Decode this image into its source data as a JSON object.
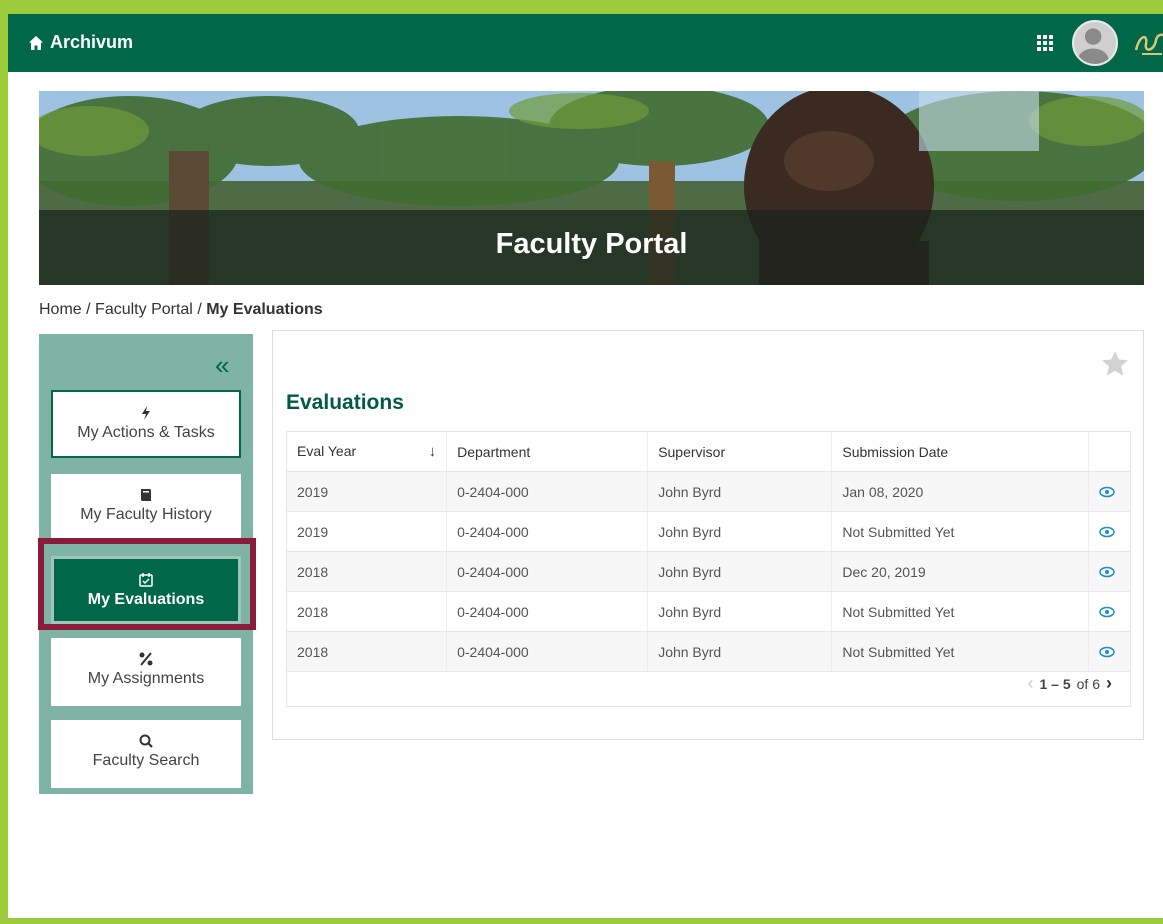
{
  "app": {
    "title": "Archivum"
  },
  "banner": {
    "title": "Faculty Portal"
  },
  "breadcrumb": {
    "home": "Home",
    "separator": "/",
    "section": "Faculty Portal",
    "current": "My Evaluations"
  },
  "sidebar": {
    "collapse_glyph": "«",
    "items": [
      {
        "label": "My Actions & Tasks",
        "icon": "bolt-icon"
      },
      {
        "label": "My Faculty History",
        "icon": "book-icon"
      },
      {
        "label": "My Evaluations",
        "icon": "calendar-check-icon",
        "active": true
      },
      {
        "label": "My Assignments",
        "icon": "percent-icon"
      },
      {
        "label": "Faculty Search",
        "icon": "search-icon"
      }
    ]
  },
  "main": {
    "title": "Evaluations",
    "table": {
      "headers": [
        "Eval Year",
        "Department",
        "Supervisor",
        "Submission Date"
      ],
      "sort_glyph": "↓",
      "rows": [
        [
          "2019",
          "0-2404-000",
          "John Byrd",
          "Jan 08, 2020"
        ],
        [
          "2019",
          "0-2404-000",
          "John Byrd",
          "Not Submitted Yet"
        ],
        [
          "2018",
          "0-2404-000",
          "John Byrd",
          "Dec 20, 2019"
        ],
        [
          "2018",
          "0-2404-000",
          "John Byrd",
          "Not Submitted Yet"
        ],
        [
          "2018",
          "0-2404-000",
          "John Byrd",
          "Not Submitted Yet"
        ]
      ]
    },
    "pager": {
      "range": "1 – 5",
      "of_label": "of 6"
    }
  },
  "colors": {
    "brand_green": "#006747",
    "sidebar_bg": "#7fb3a3",
    "highlight": "#8a1b3b",
    "accent_blue": "#1a8fc9",
    "outer_frame": "#9ccc3c"
  }
}
